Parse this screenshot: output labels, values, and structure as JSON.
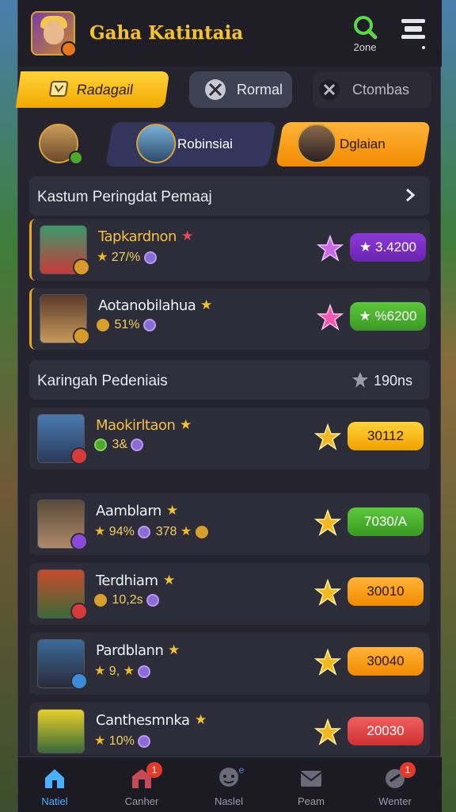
{
  "header": {
    "title": "Gaha Katintaia",
    "zone_label": "2one"
  },
  "tabs": [
    {
      "label": "Radagail",
      "active": true
    },
    {
      "label": "Rormal",
      "active": false
    },
    {
      "label": "Ctombas",
      "active": false
    }
  ],
  "characters": [
    {
      "label": ""
    },
    {
      "label": "Robinsiai"
    },
    {
      "label": "Dglaian"
    }
  ],
  "section1": {
    "title": "Kastum Peringdat Pemaaj"
  },
  "section2": {
    "title": "Karingah Pedeniais",
    "right_label": "190ns"
  },
  "rows": [
    {
      "name": "Tapkardnon",
      "stat1": "27/%",
      "price": "3.4200",
      "color": "purple"
    },
    {
      "name": "Aotanobilahua",
      "stat1": "51%",
      "price": "%6200",
      "color": "green"
    },
    {
      "name": "Maokirltaon",
      "stat1": "3&",
      "price": "30112",
      "color": "yellow"
    },
    {
      "name": "Aamblarn",
      "stat1": "94%",
      "stat2": "378",
      "price": "7030/A",
      "color": "green"
    },
    {
      "name": "Terdhiam",
      "stat1": "10,2s",
      "price": "30010",
      "color": "orange"
    },
    {
      "name": "Pardblann",
      "stat1": "9,",
      "price": "30040",
      "color": "orange"
    },
    {
      "name": "Canthesmnka",
      "stat1": "10%",
      "price": "20030",
      "color": "red"
    }
  ],
  "bottom_nav": [
    {
      "label": "Natiel",
      "active": true
    },
    {
      "label": "Canher",
      "badge": "1"
    },
    {
      "label": "Naslel",
      "badge": "e"
    },
    {
      "label": "Peam"
    },
    {
      "label": "Wenter",
      "badge": "1"
    }
  ],
  "colors": {
    "accent_yellow": "#f2c232",
    "panel": "#24232e",
    "row": "#2d2c39"
  }
}
